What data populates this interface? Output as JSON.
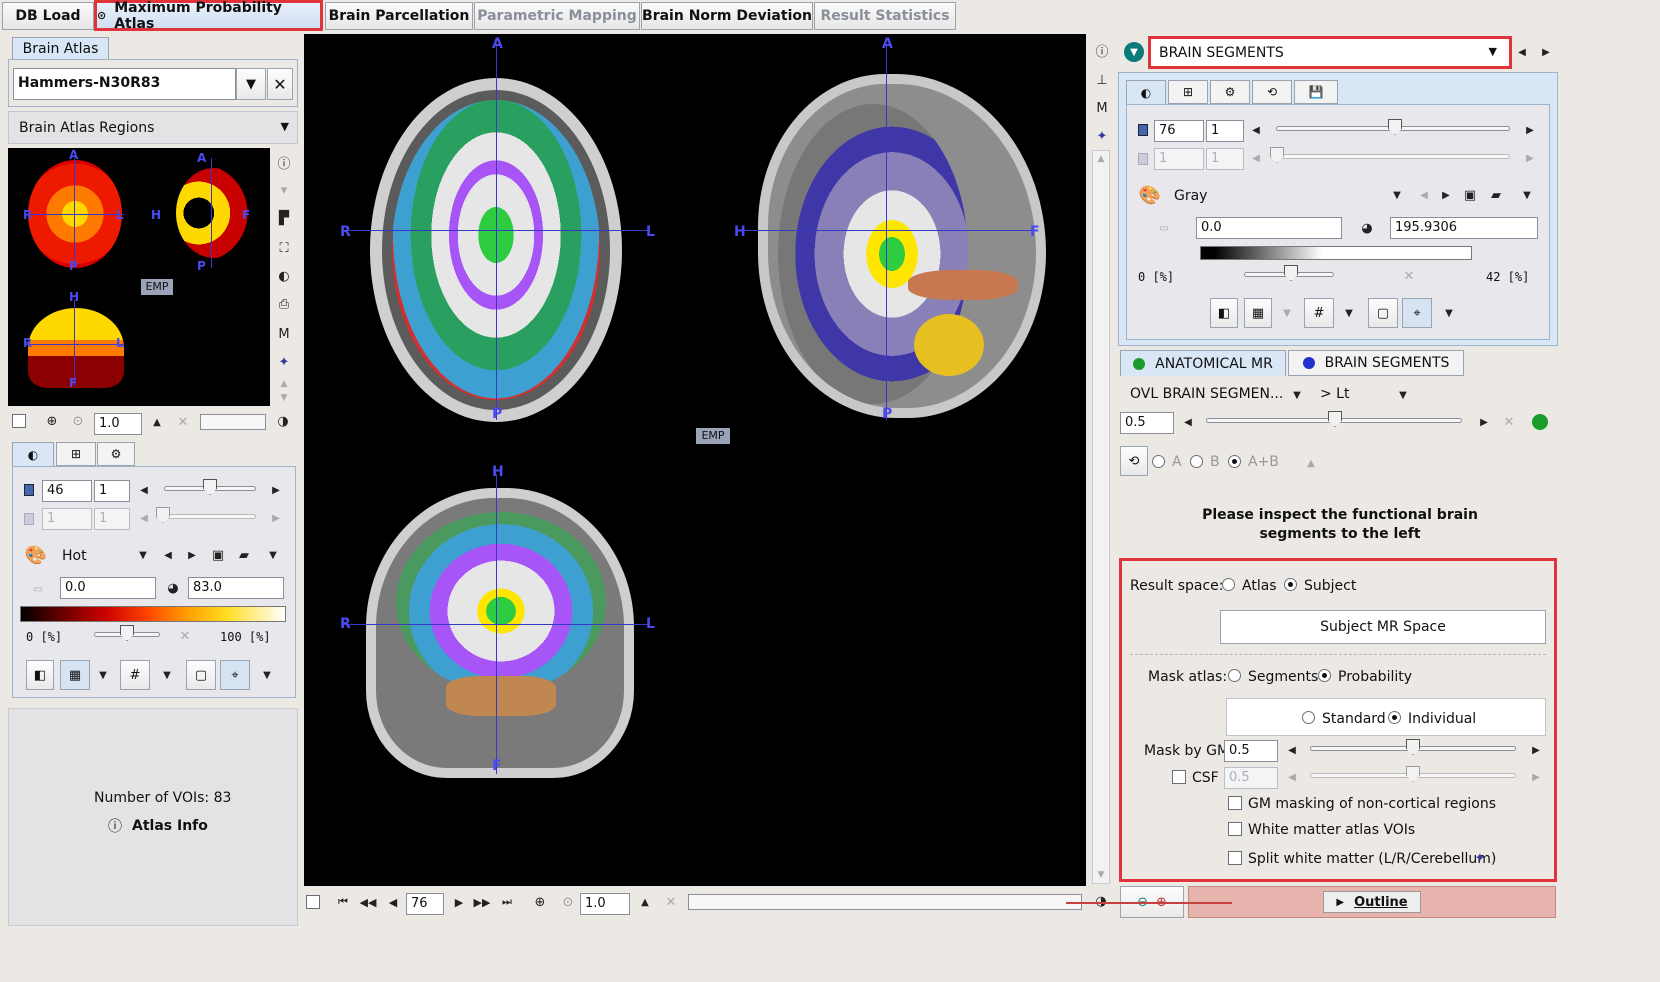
{
  "tabs": [
    {
      "label": "DB Load",
      "state": "normal"
    },
    {
      "label": "Maximum Probability Atlas",
      "state": "active"
    },
    {
      "label": "Brain Parcellation",
      "state": "normal"
    },
    {
      "label": "Parametric Mapping",
      "state": "disabled"
    },
    {
      "label": "Brain Norm Deviation",
      "state": "normal"
    },
    {
      "label": "Result Statistics",
      "state": "disabled"
    }
  ],
  "left": {
    "atlas_tab": "Brain Atlas",
    "atlas_select": "Hammers-N30R83",
    "regions_select": "Brain Atlas Regions",
    "thumb_zoom": "1.0",
    "emp_badge": "EMP",
    "lut": {
      "slice": "46",
      "step": "1",
      "slice2": "1",
      "step2": "1",
      "colormap": "Hot",
      "min": "0.0",
      "max": "83.0",
      "pct_min": "0 [%]",
      "pct_max": "100 [%]"
    },
    "voi_count": "Number of VOIs: 83",
    "atlas_info": "Atlas Info"
  },
  "viewer": {
    "labels": {
      "A": "A",
      "P": "P",
      "R": "R",
      "L": "L",
      "H": "H",
      "F": "F"
    },
    "emp_badge": "EMP",
    "slice": "76",
    "zoom": "1.0"
  },
  "right": {
    "series_select": "BRAIN SEGMENTS",
    "lut": {
      "slice": "76",
      "step": "1",
      "slice2": "1",
      "step2": "1",
      "colormap": "Gray",
      "min": "0.0",
      "max": "195.9306",
      "pct_min": "0 [%]",
      "pct_max": "42 [%]"
    },
    "series_tabs": [
      "ANATOMICAL MR",
      "BRAIN SEGMENTS"
    ],
    "ovl_label": "OVL  BRAIN SEGMEN...",
    "ovl_mode": "> Lt",
    "ovl_value": "0.5",
    "blend": {
      "a": "A",
      "b": "B",
      "ab": "A+B"
    },
    "instruction": "Please inspect the functional brain segments to the left",
    "result_space_label": "Result space:",
    "result_space_options": [
      "Atlas",
      "Subject"
    ],
    "subject_space_button": "Subject MR Space",
    "mask_atlas_label": "Mask atlas:",
    "mask_atlas_options": [
      "Segments",
      "Probability"
    ],
    "prob_options": [
      "Standard",
      "Individual"
    ],
    "mask_gm_label": "Mask by GM",
    "mask_gm_value": "0.5",
    "csf_label": "CSF",
    "csf_value": "0.5",
    "checks": [
      "GM masking of non-cortical regions",
      "White matter atlas VOIs",
      "Split white matter (L/R/Cerebellum)"
    ],
    "outline_button": "Outline"
  }
}
